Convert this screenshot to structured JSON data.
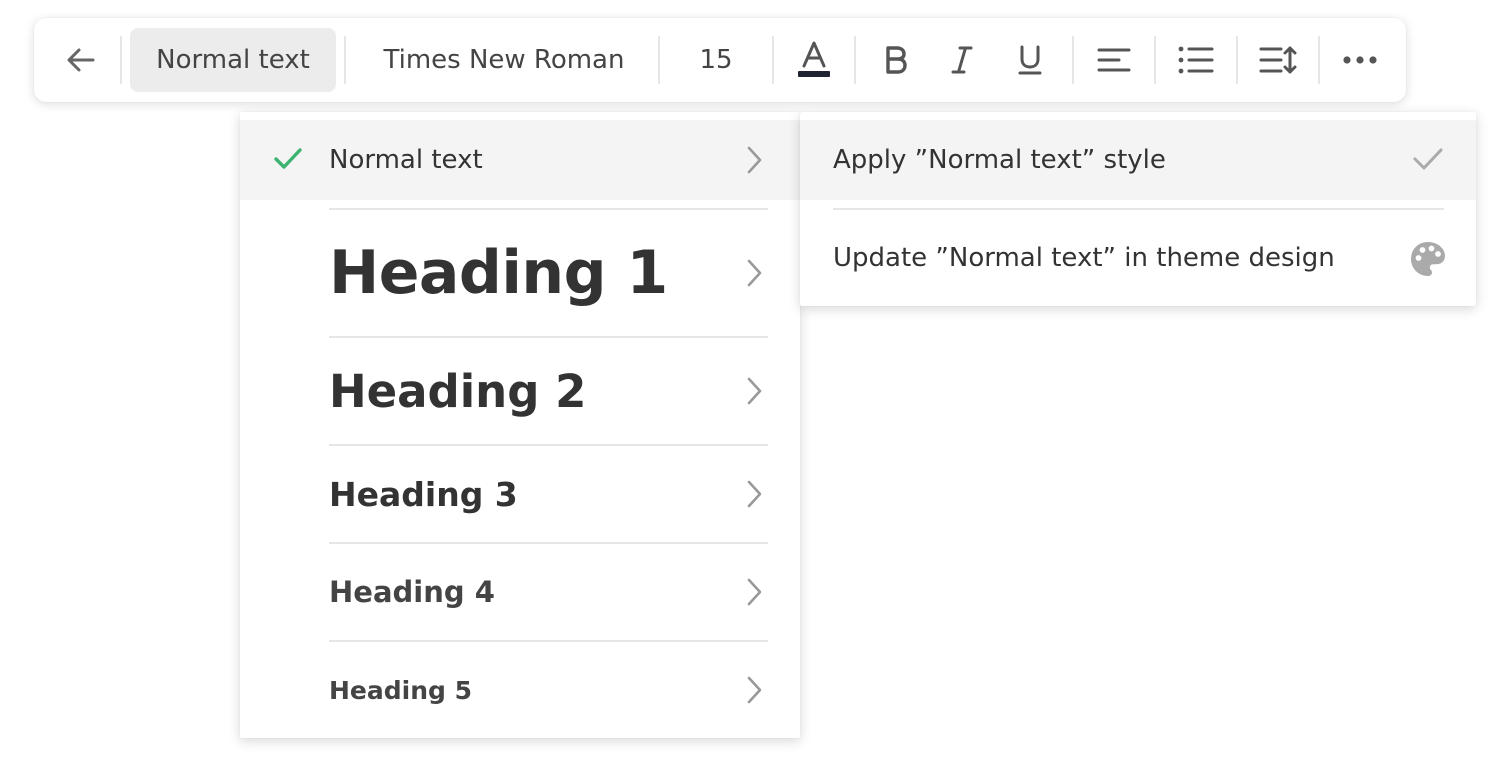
{
  "toolbar": {
    "back_icon": "arrow-left-icon",
    "style_label": "Normal text",
    "font_label": "Times New Roman",
    "size_label": "15",
    "text_color_icon": "text-color-icon",
    "text_color_value": "#1f2430",
    "bold_icon": "bold-icon",
    "italic_icon": "italic-icon",
    "underline_icon": "underline-icon",
    "align_icon": "align-left-icon",
    "list_icon": "bulleted-list-icon",
    "line_spacing_icon": "line-spacing-icon",
    "more_icon": "more-icon"
  },
  "style_menu": {
    "selected_index": 0,
    "check_color": "#3cb371",
    "items": [
      {
        "label": "Normal text"
      },
      {
        "label": "Heading 1"
      },
      {
        "label": "Heading 2"
      },
      {
        "label": "Heading 3"
      },
      {
        "label": "Heading 4"
      },
      {
        "label": "Heading 5"
      }
    ]
  },
  "submenu": {
    "items": [
      {
        "label": "Apply ”Normal text” style",
        "icon": "checkmark-icon"
      },
      {
        "label": "Update ”Normal text” in theme design",
        "icon": "palette-icon"
      }
    ]
  }
}
